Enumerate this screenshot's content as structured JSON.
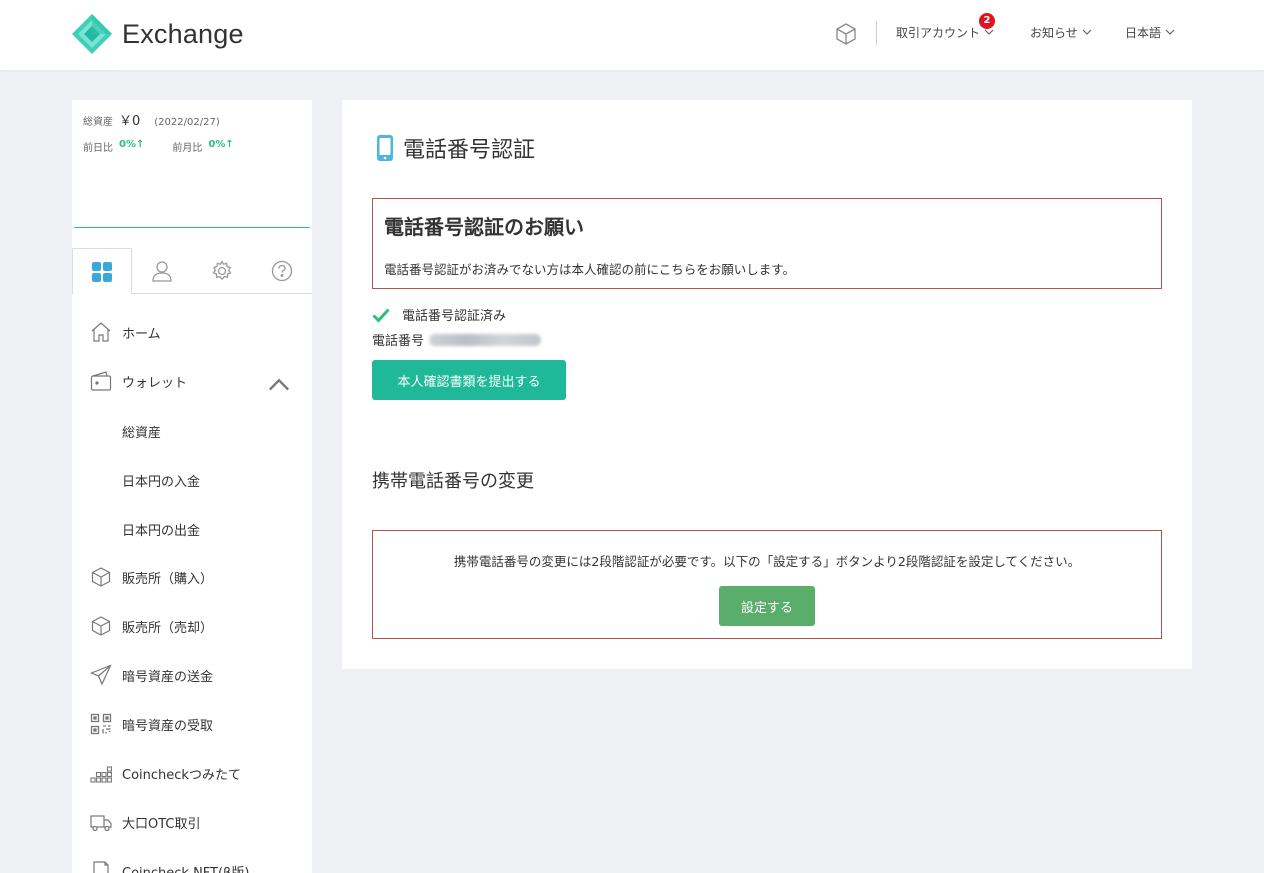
{
  "header": {
    "logo_text": "Exchange",
    "menu": [
      {
        "label": "取引アカウント",
        "badge": "2"
      },
      {
        "label": "お知らせ"
      },
      {
        "label": "日本語"
      }
    ]
  },
  "sidebar": {
    "assets": {
      "total_label": "総資産",
      "total_value": "￥0",
      "date": "(2022/02/27)",
      "day_label": "前日比",
      "day_value": "0%↑",
      "month_label": "前月比",
      "month_value": "0%↑"
    },
    "tabs": [
      {
        "icon": "dashboard-icon"
      },
      {
        "icon": "user-icon"
      },
      {
        "icon": "gear-icon"
      },
      {
        "icon": "help-icon"
      }
    ],
    "nav": [
      {
        "label": "ホーム",
        "icon": "home-icon"
      },
      {
        "label": "ウォレット",
        "icon": "wallet-icon"
      },
      {
        "label": "総資産"
      },
      {
        "label": "日本円の入金"
      },
      {
        "label": "日本円の出金"
      },
      {
        "label": "販売所（購入）",
        "icon": "cube-icon"
      },
      {
        "label": "販売所（売却）",
        "icon": "cube-icon"
      },
      {
        "label": "暗号資産の送金",
        "icon": "send-icon"
      },
      {
        "label": "暗号資産の受取",
        "icon": "qr-icon"
      },
      {
        "label": "Coincheckつみたて",
        "icon": "stack-icon"
      },
      {
        "label": "大口OTC取引",
        "icon": "truck-icon"
      },
      {
        "label": "Coincheck NFT(β版)",
        "icon": "nft-icon"
      }
    ]
  },
  "main": {
    "title": "電話番号認証",
    "alert1": {
      "heading": "電話番号認証のお願い",
      "text": "電話番号認証がお済みでない方は本人確認の前にこちらをお願いします。"
    },
    "verified_text": "電話番号認証済み",
    "phone_label": "電話番号",
    "submit_button": "本人確認書類を提出する",
    "section2_title": "携帯電話番号の変更",
    "alert2": {
      "text": "携帯電話番号の変更には2段階認証が必要です。以下の「設定する」ボタンより2段階認証を設定してください。",
      "button": "設定する"
    }
  },
  "colors": {
    "accent": "#2bc07e",
    "primary_button": "#1fb898",
    "secondary_button": "#5aad6a",
    "alert_border": "#b5534d",
    "badge": "#e0141e"
  }
}
